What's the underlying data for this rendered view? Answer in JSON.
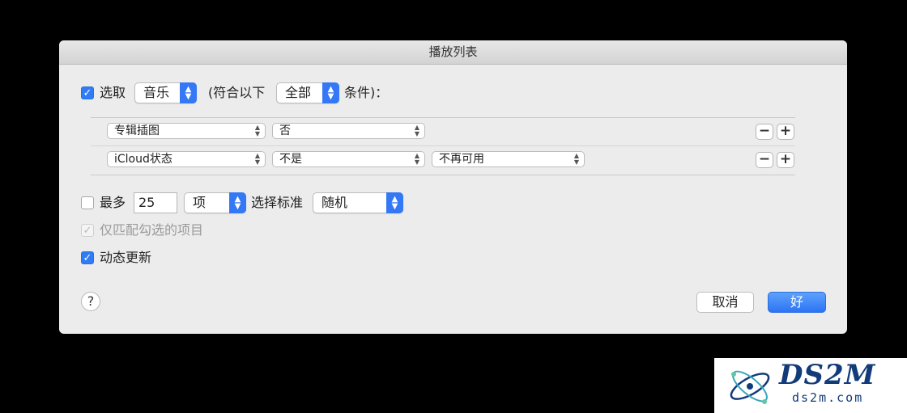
{
  "window": {
    "title": "播放列表"
  },
  "match": {
    "checkbox_checked": true,
    "select_label": "选取",
    "media_value": "音乐",
    "conditions_prefix": "(符合以下",
    "conditions_value": "全部",
    "conditions_suffix": "条件)："
  },
  "rules": [
    {
      "field": "专辑插图",
      "operator": "否",
      "value": null
    },
    {
      "field": "iCloud状态",
      "operator": "不是",
      "value": "不再可用"
    }
  ],
  "rule_buttons": {
    "remove": "−",
    "add": "+"
  },
  "limit": {
    "checked": false,
    "label": "最多",
    "count": "25",
    "unit": "项",
    "criteria_label": "选择标准",
    "criteria_value": "随机"
  },
  "match_checked_only": {
    "checked": true,
    "enabled": false,
    "label": "仅匹配勾选的项目"
  },
  "live_update": {
    "checked": true,
    "label": "动态更新"
  },
  "buttons": {
    "help": "?",
    "cancel": "取消",
    "ok": "好"
  },
  "watermark": {
    "brand": "DS2M",
    "url": "ds2m.com"
  },
  "colors": {
    "accent": "#2f7cf6",
    "dialog_bg": "#ececec",
    "screen_bg": "#000000",
    "watermark_text": "#123b7a"
  }
}
